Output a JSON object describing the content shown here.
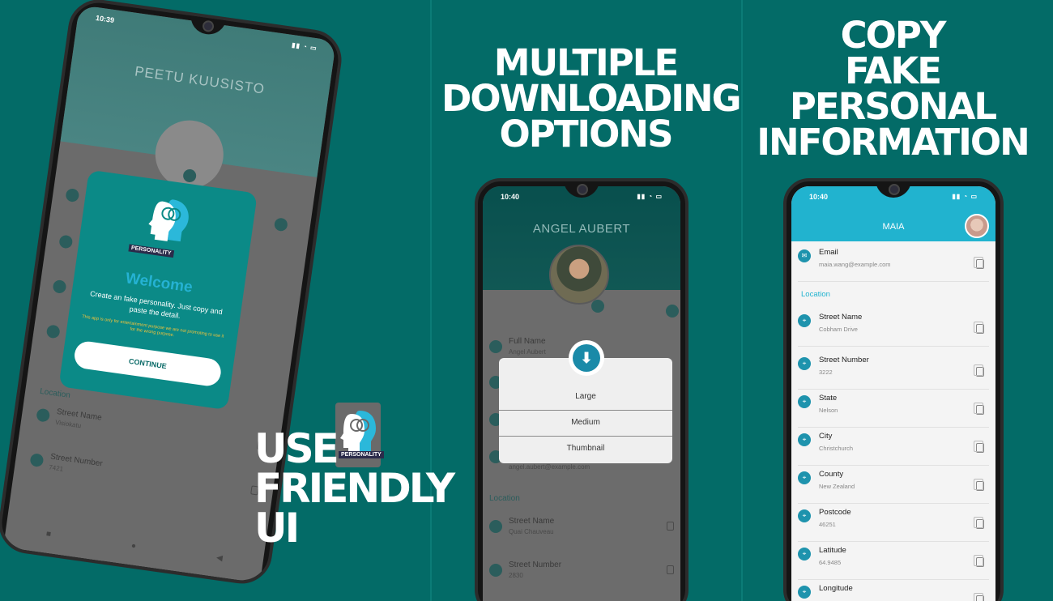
{
  "colors": {
    "background": "#036b67",
    "accent": "#21b3cf",
    "welcome_title": "#25b2d3"
  },
  "panel1": {
    "headline": [
      "USE",
      "FRIENDLY",
      "UI"
    ],
    "phone": {
      "status_time": "10:39",
      "profile_name": "PEETU KUUSISTO",
      "welcome": {
        "logo_text": "PERSONALITY",
        "title": "Welcome",
        "description": "Create an fake personality. Just copy and paste the detail.",
        "note": "This app is only for entertainment purpose we are not promoting to use it for the wrong purpose.",
        "continue_label": "CONTINUE"
      },
      "section_location": "Location",
      "fields": [
        {
          "label": "Street Name",
          "value": "Visiokatu"
        },
        {
          "label": "Street Number",
          "value": "7421"
        }
      ]
    },
    "app_logo_text": "PERSONALITY"
  },
  "panel2": {
    "headline": [
      "MULTIPLE",
      "DOWNLOADING",
      "OPTIONS"
    ],
    "phone": {
      "status_time": "10:40",
      "profile_name": "ANGEL AUBERT",
      "fields_bg": [
        {
          "label": "Full Name",
          "value": "Angel Aubert"
        }
      ],
      "email_hint": "angel.aubert@example.com",
      "section_location": "Location",
      "fields_bottom": [
        {
          "label": "Street Name",
          "value": "Quai Chauveau"
        },
        {
          "label": "Street Number",
          "value": "2830"
        }
      ],
      "download_options": [
        "Large",
        "Medium",
        "Thumbnail"
      ]
    }
  },
  "panel3": {
    "headline": [
      "COPY",
      "FAKE",
      "PERSONAL",
      "INFORMATION"
    ],
    "phone": {
      "status_time": "10:40",
      "title": "MAIA",
      "email": {
        "label": "Email",
        "value": "maia.wang@example.com"
      },
      "section_location": "Location",
      "fields": [
        {
          "label": "Street Name",
          "value": "Cobham Drive"
        },
        {
          "label": "Street Number",
          "value": "3222"
        },
        {
          "label": "State",
          "value": "Nelson"
        },
        {
          "label": "City",
          "value": "Christchurch"
        },
        {
          "label": "County",
          "value": "New Zealand"
        },
        {
          "label": "Postcode",
          "value": "46251"
        },
        {
          "label": "Latitude",
          "value": "64.9485"
        },
        {
          "label": "Longitude",
          "value": ""
        }
      ]
    }
  }
}
